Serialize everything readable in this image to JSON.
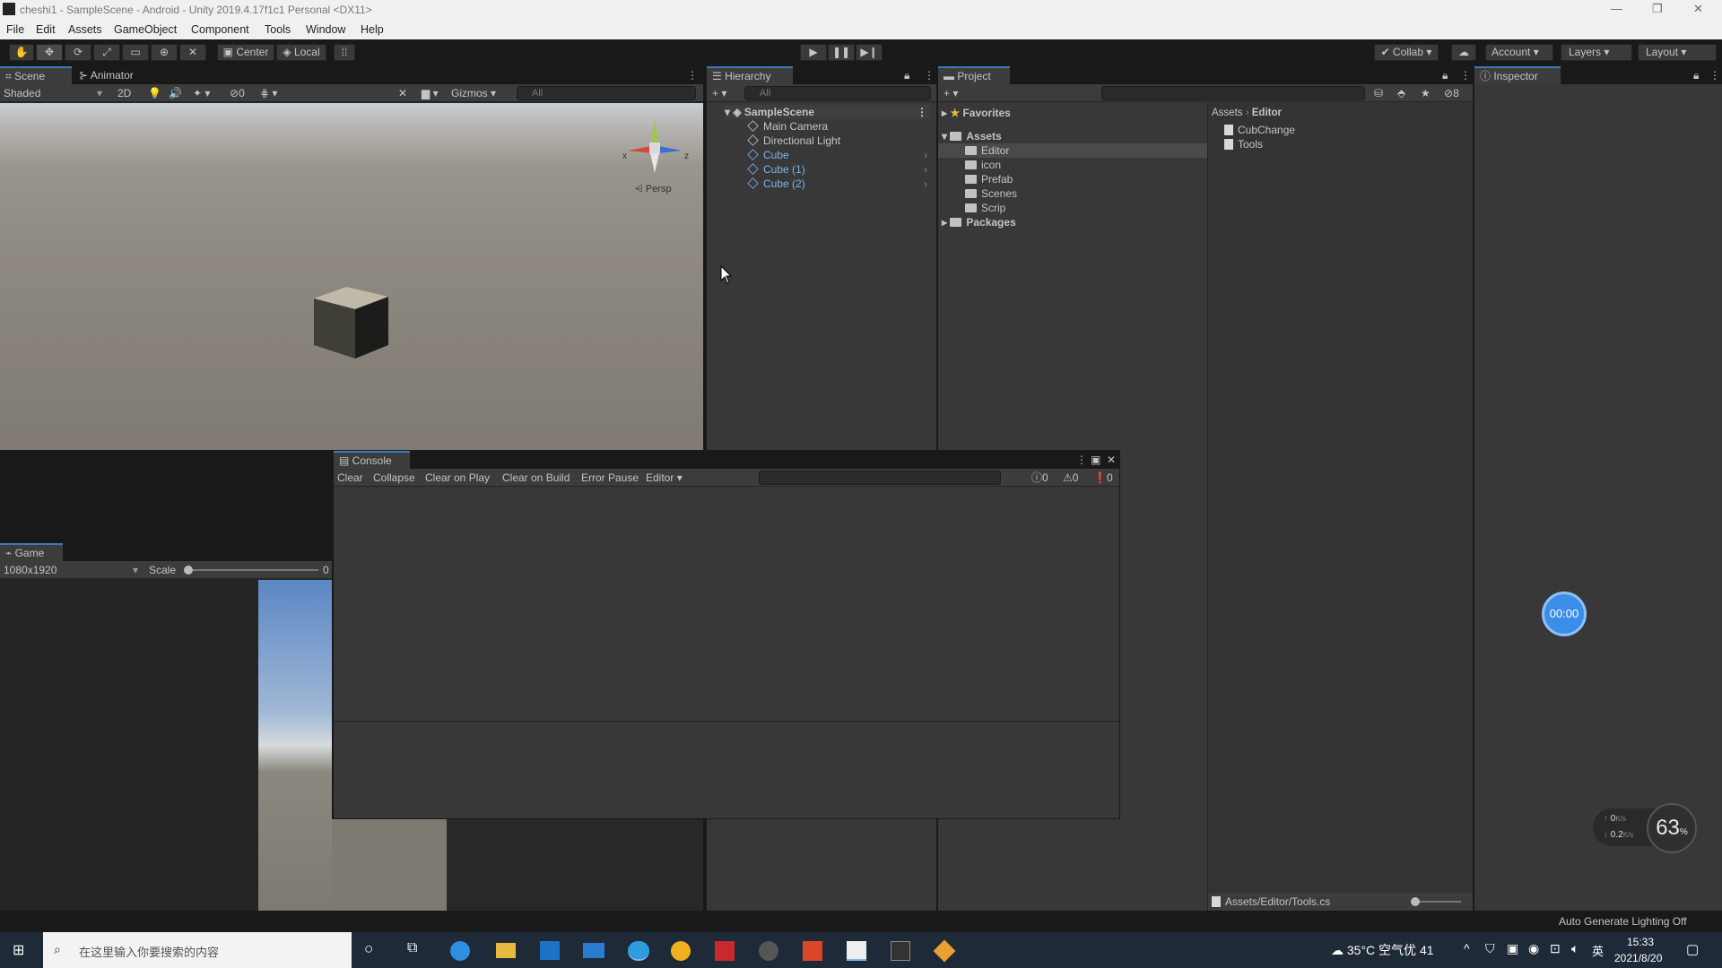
{
  "window": {
    "title": "cheshi1 - SampleScene - Android - Unity 2019.4.17f1c1 Personal <DX11>",
    "controls": [
      "—",
      "❐",
      "✕"
    ]
  },
  "menu": [
    "File",
    "Edit",
    "Assets",
    "GameObject",
    "Component",
    "Tools",
    "Window",
    "Help"
  ],
  "toolbar": {
    "center": "Center",
    "local": "Local",
    "collab": "Collab",
    "account": "Account",
    "layers": "Layers",
    "layout": "Layout"
  },
  "scene": {
    "tab_scene": "Scene",
    "tab_animator": "Animator",
    "shading": "Shaded",
    "mode2d": "2D",
    "gizmos": "Gizmos",
    "hidden_count": "0",
    "search": "All",
    "persp": "Persp",
    "axis_x": "x",
    "axis_z": "z"
  },
  "hierarchy": {
    "tab": "Hierarchy",
    "search": "All",
    "scene": "SampleScene",
    "items": [
      "Main Camera",
      "Directional Light",
      "Cube",
      "Cube (1)",
      "Cube (2)"
    ]
  },
  "project": {
    "tab": "Project",
    "badge": "8",
    "favorites": "Favorites",
    "assets": "Assets",
    "folders": [
      "Editor",
      "icon",
      "Prefab",
      "Scenes",
      "Scrip"
    ],
    "packages": "Packages",
    "breadcrumb": [
      "Assets",
      "Editor"
    ],
    "files": [
      "CubChange",
      "Tools"
    ],
    "status_path": "Assets/Editor/Tools.cs"
  },
  "inspector": {
    "tab": "Inspector"
  },
  "console": {
    "tab": "Console",
    "buttons": [
      "Clear",
      "Collapse",
      "Clear on Play",
      "Clear on Build",
      "Error Pause",
      "Editor"
    ],
    "log_count": "0",
    "warn_count": "0",
    "error_count": "0"
  },
  "game": {
    "tab": "Game",
    "resolution": "1080x1920",
    "scale_label": "Scale",
    "scale_value": "0"
  },
  "status": {
    "lighting": "Auto Generate Lighting Off"
  },
  "overlay": {
    "timer": "00:00",
    "percent": "63",
    "percent_unit": "%",
    "up_speed": "0",
    "down_speed": "0.2",
    "speed_unit": "K/s"
  },
  "taskbar": {
    "search_placeholder": "在这里输入你要搜索的内容",
    "weather": "35°C 空气优 41",
    "ime": "英",
    "time": "15:33",
    "date": "2021/8/20"
  }
}
